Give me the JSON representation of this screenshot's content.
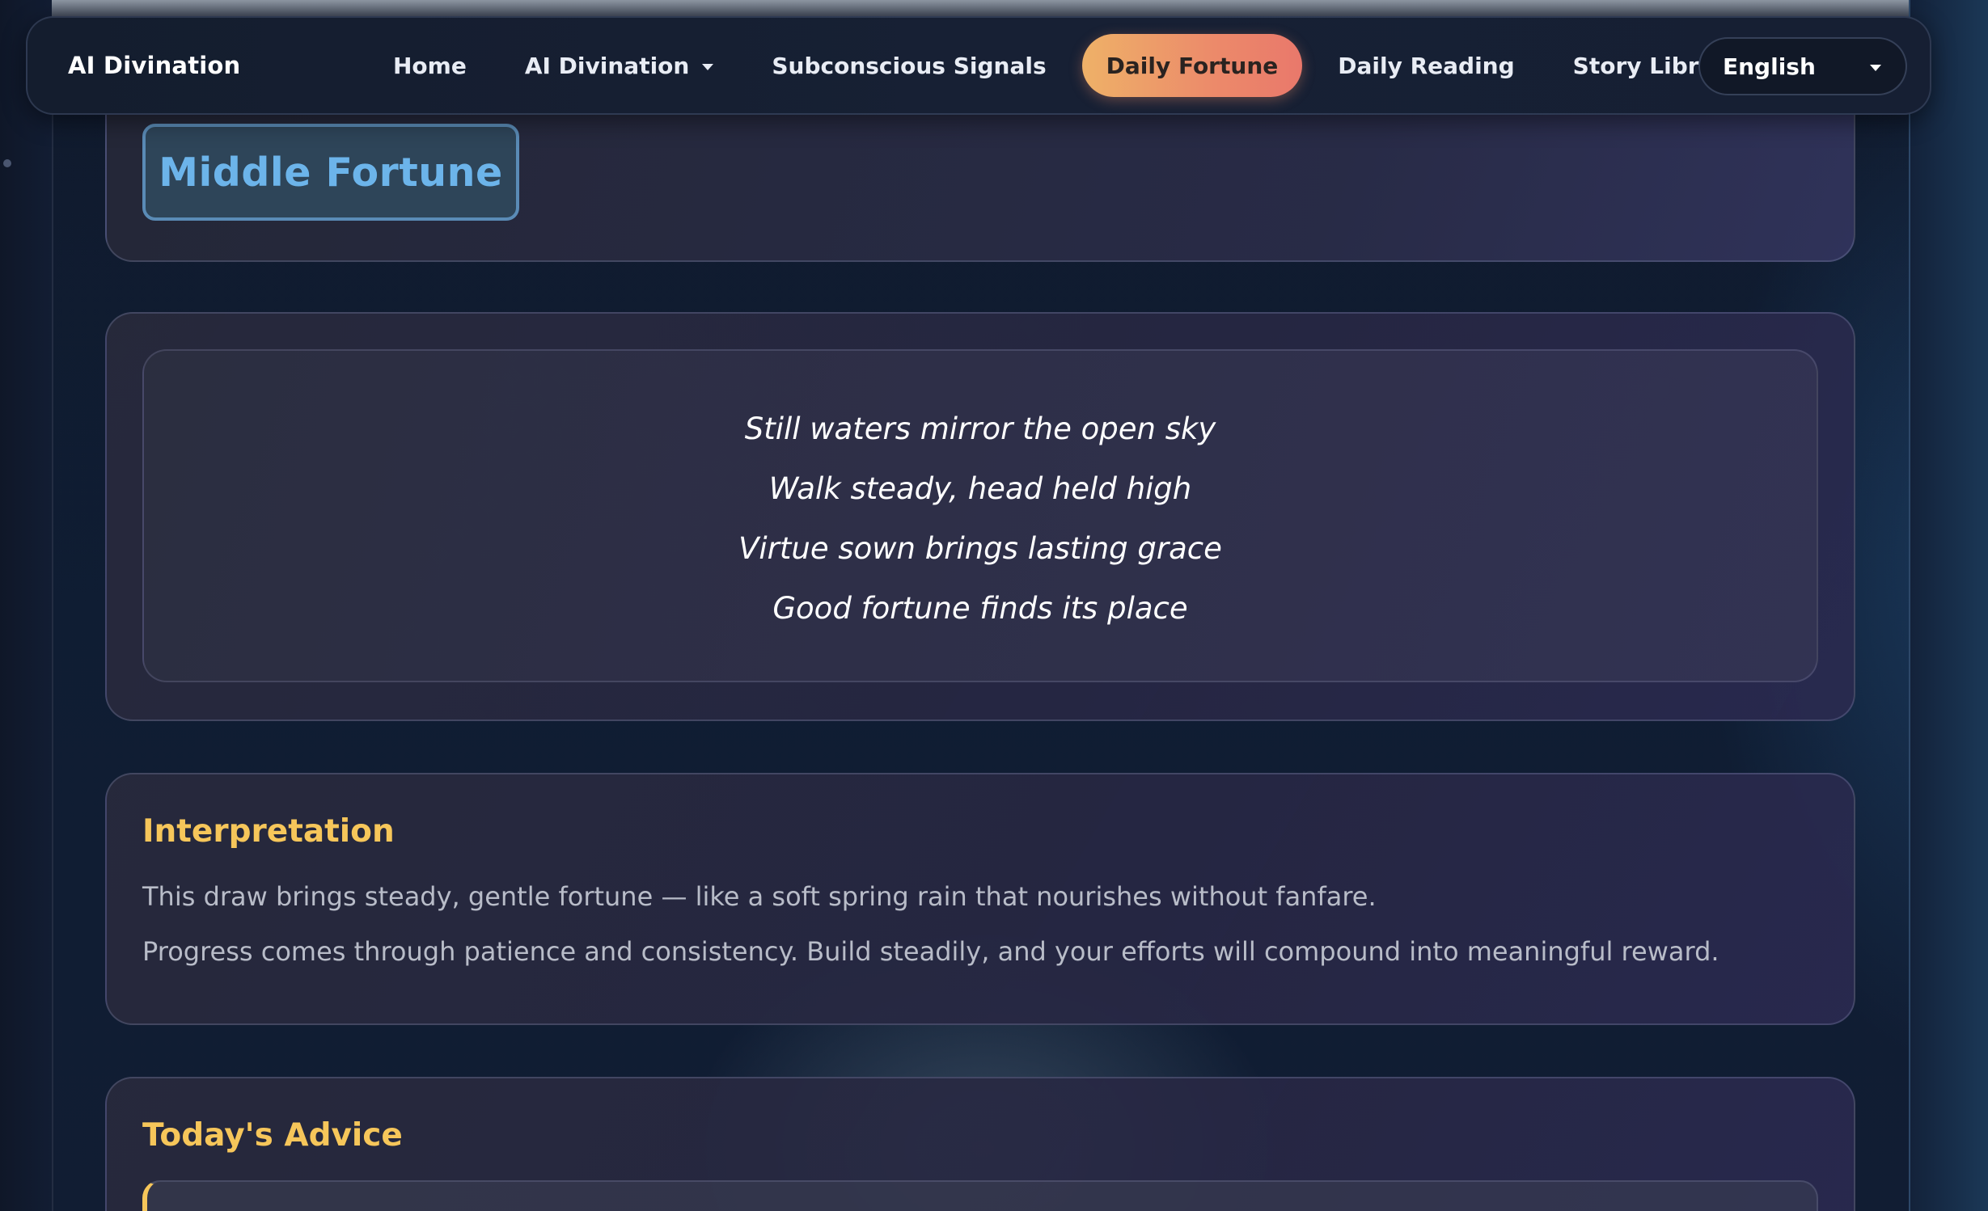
{
  "nav": {
    "brand": "AI Divination",
    "items": [
      {
        "label": "Home",
        "active": false,
        "dropdown": false
      },
      {
        "label": "AI Divination",
        "active": false,
        "dropdown": true
      },
      {
        "label": "Subconscious Signals",
        "active": false,
        "dropdown": false
      },
      {
        "label": "Daily Fortune",
        "active": true,
        "dropdown": false
      },
      {
        "label": "Daily Reading",
        "active": false,
        "dropdown": false
      },
      {
        "label": "Story Library",
        "active": false,
        "dropdown": false
      }
    ],
    "language": "English"
  },
  "fortune": {
    "level": "Middle Fortune"
  },
  "poem": {
    "lines": [
      "Still waters mirror the open sky",
      "Walk steady, head held high",
      "Virtue sown brings lasting grace",
      "Good fortune finds its place"
    ]
  },
  "interpretation": {
    "title": "Interpretation",
    "paragraphs": [
      "This draw brings steady, gentle fortune — like a soft spring rain that nourishes without fanfare.",
      "Progress comes through patience and consistency. Build steadily, and your efforts will compound into meaningful reward."
    ]
  },
  "advice": {
    "title": "Today's Advice"
  },
  "colors": {
    "accent_gold": "#f6c65a",
    "active_tab_start": "#eeb168",
    "active_tab_end": "#e9786b",
    "fortune_blue": "#6cb4ea"
  }
}
